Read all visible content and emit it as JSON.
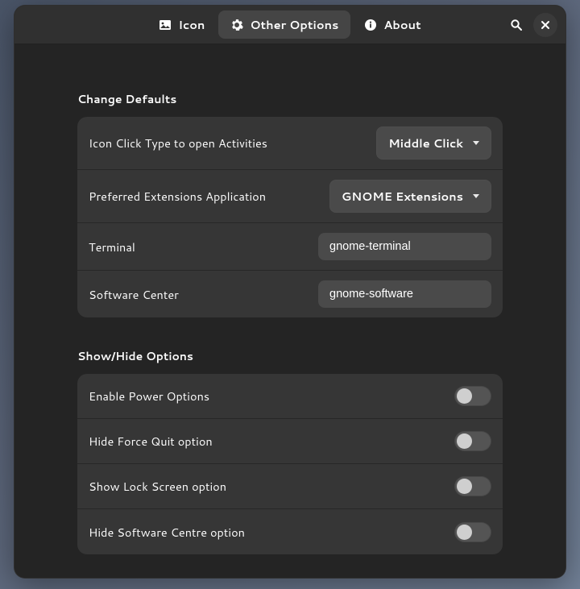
{
  "tabs": {
    "icon": "Icon",
    "other": "Other Options",
    "about": "About"
  },
  "sections": {
    "defaults": {
      "title": "Change Defaults",
      "rows": {
        "clickType": {
          "label": "Icon Click Type to open Activities",
          "value": "Middle Click"
        },
        "extApp": {
          "label": "Preferred Extensions Application",
          "value": "GNOME Extensions"
        },
        "terminal": {
          "label": "Terminal",
          "value": "gnome-terminal"
        },
        "software": {
          "label": "Software Center",
          "value": "gnome-software"
        }
      }
    },
    "showhide": {
      "title": "Show/Hide Options",
      "rows": {
        "power": {
          "label": "Enable Power Options",
          "on": false
        },
        "forcequit": {
          "label": "Hide Force Quit option",
          "on": false
        },
        "lock": {
          "label": "Show Lock Screen option",
          "on": false
        },
        "swcentre": {
          "label": "Hide Software Centre option",
          "on": false
        }
      }
    }
  }
}
